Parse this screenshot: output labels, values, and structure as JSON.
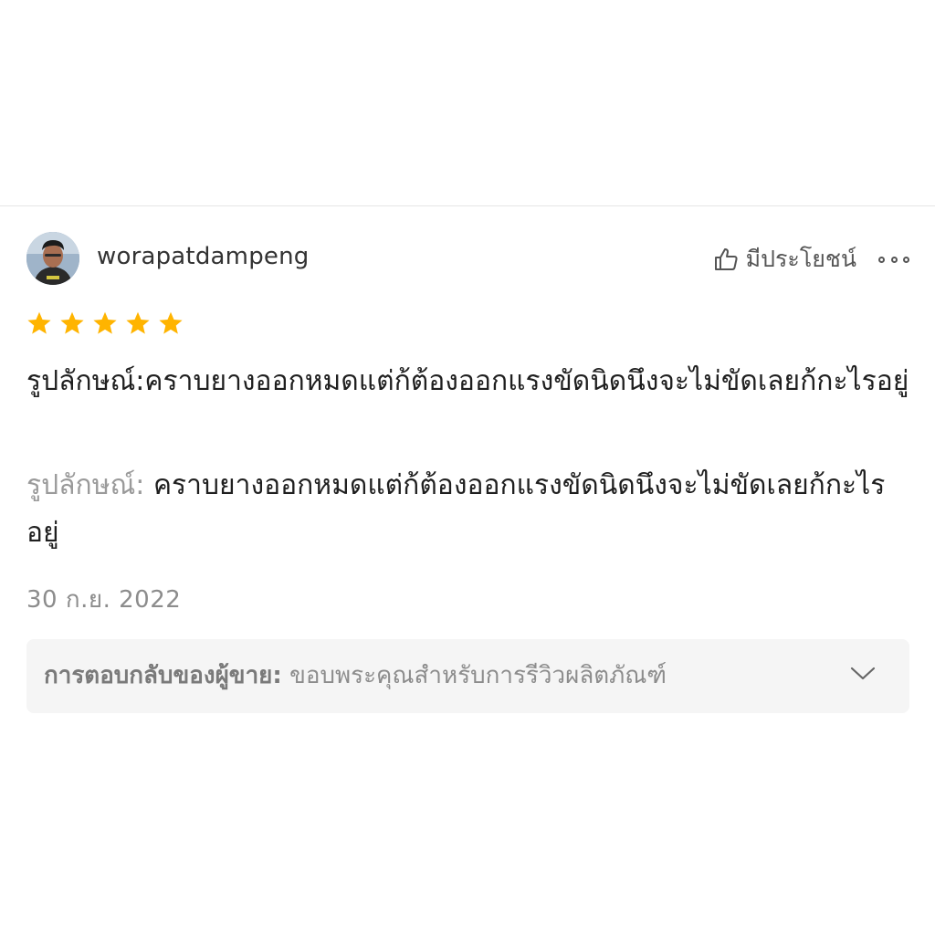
{
  "review": {
    "username": "worapatdampeng",
    "helpful_label": "มีประโยชน์",
    "rating": 5,
    "rating_max": 5,
    "star_color": "#FFB400",
    "comment_text": "รูปลักษณ์:คราบยางออกหมดแต่ก้ต้องออกแรงขัดนิดนึงจะไม่ขัดเลยก้กะไรอยู่",
    "attribute_label": "รูปลักษณ์:",
    "attribute_value": "คราบยางออกหมดแต่ก้ต้องออกแรงขัดนิดนึงจะไม่ขัดเลยก้กะไรอยู่",
    "date": "30 ก.ย. 2022",
    "icons": {
      "avatar": "avatar",
      "helpful": "thumbs-up-outline-icon",
      "more": "more-dots-icon",
      "expand": "chevron-down-icon"
    }
  },
  "seller_reply": {
    "label": "การตอบกลับของผู้ขาย:",
    "text": "ขอบพระคุณสำหรับการรีวิวผลิตภัณฑ์"
  }
}
